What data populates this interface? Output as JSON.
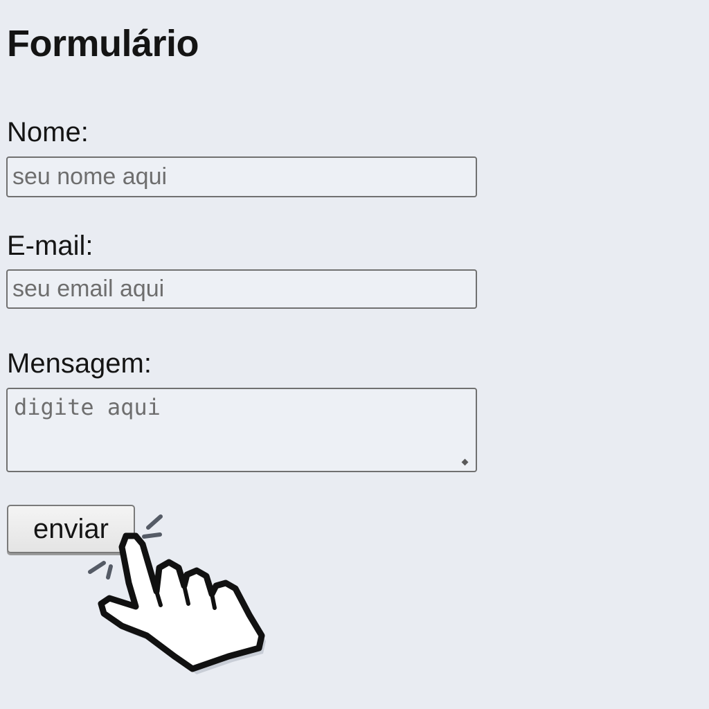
{
  "form": {
    "title": "Formulário",
    "name_label": "Nome:",
    "name_placeholder": "seu nome aqui",
    "email_label": "E-mail:",
    "email_placeholder": "seu email aqui",
    "message_label": "Mensagem:",
    "message_placeholder": "digite aqui",
    "submit_label": "enviar"
  },
  "cursor": {
    "icon": "hand-pointer-icon",
    "state": "clicking"
  }
}
